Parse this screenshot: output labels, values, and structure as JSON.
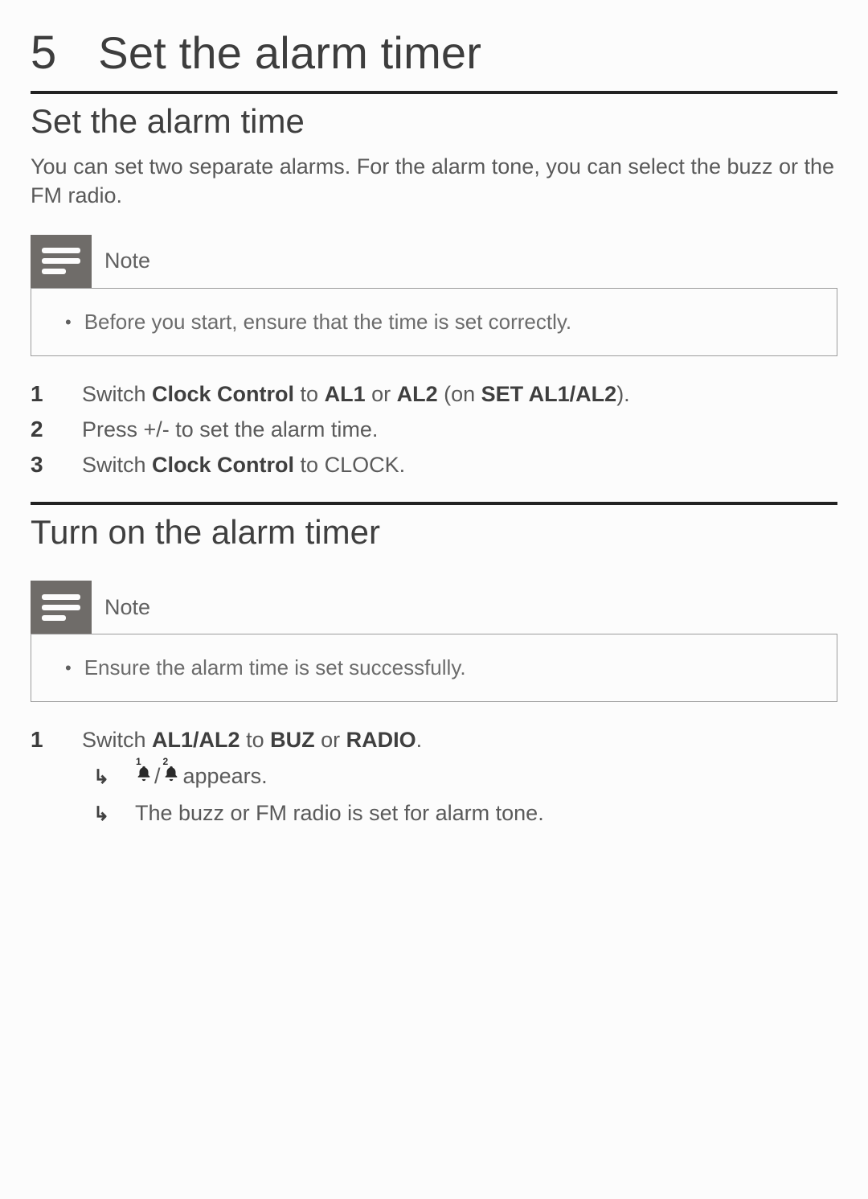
{
  "chapter": {
    "number": "5",
    "title": "Set the alarm timer"
  },
  "section1": {
    "title": "Set the alarm time",
    "intro": "You can set two separate alarms. For the alarm tone, you can select the buzz or the FM radio.",
    "note_label": "Note",
    "note_text": "Before you start, ensure that the time is set correctly.",
    "steps": {
      "s1_a": "Switch ",
      "s1_b": "Clock Control",
      "s1_c": " to ",
      "s1_d": "AL1",
      "s1_e": " or ",
      "s1_f": "AL2",
      "s1_g": " (on ",
      "s1_h": "SET AL1/AL2",
      "s1_i": ").",
      "s2": "Press +/- to set the alarm time.",
      "s3_a": "Switch ",
      "s3_b": "Clock Control",
      "s3_c": " to CLOCK."
    }
  },
  "section2": {
    "title": "Turn on the alarm timer",
    "note_label": "Note",
    "note_text": "Ensure the alarm time is set successfully.",
    "step1": {
      "a": "Switch ",
      "b": "AL1/AL2",
      "c": " to ",
      "d": "BUZ",
      "e": " or ",
      "f": "RADIO",
      "g": ".",
      "r1_icon_sep": "/",
      "r1_tail": " appears.",
      "r2": "The buzz or FM radio is set for alarm tone."
    }
  },
  "icons": {
    "note": "note-lines-icon",
    "result_arrow": "↳",
    "bell1": "bell-1-icon",
    "bell2": "bell-2-icon"
  }
}
